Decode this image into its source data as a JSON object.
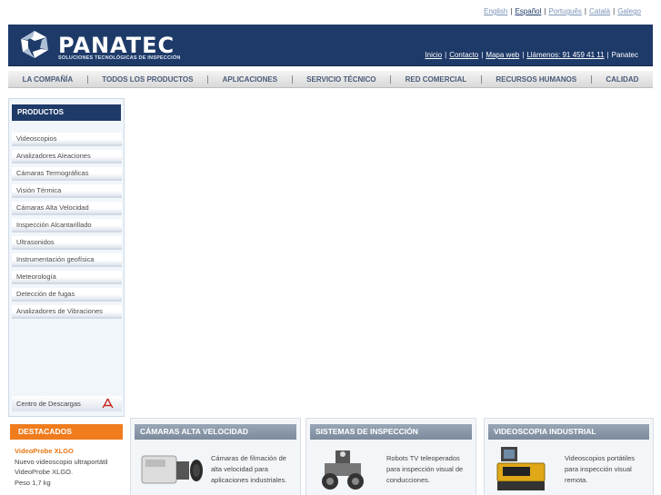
{
  "languages": [
    {
      "label": "English",
      "active": false
    },
    {
      "label": "Español",
      "active": true
    },
    {
      "label": "Português",
      "active": false
    },
    {
      "label": "Català",
      "active": false
    },
    {
      "label": "Galego",
      "active": false
    }
  ],
  "header": {
    "brand": "PANATEC",
    "tagline": "SOLUCIONES TECNOLÓGICAS DE INSPECCIÓN",
    "nav": [
      "Inicio",
      "Contacto",
      "Mapa web",
      "Llámenos: 91 459 41 11"
    ],
    "nav_suffix": "Panatec"
  },
  "main_menu": [
    "LA COMPAÑÍA",
    "TODOS LOS PRODUCTOS",
    "APLICACIONES",
    "SERVICIO TÉCNICO",
    "RED COMERCIAL",
    "RECURSOS HUMANOS",
    "CALIDAD"
  ],
  "sidebar": {
    "title": "PRODUCTOS",
    "items": [
      "Videoscopios",
      "Analizadores Aleaciones",
      "Cámaras Termográficas",
      "Visión Térmica",
      "Cámaras Alta Velocidad",
      "Inspección Alcantarillado",
      "Ultrasonidos",
      "Instrumentación geofísica",
      "Meteorología",
      "Detección de fugas",
      "Analizadores de Vibraciones"
    ],
    "downloads": "Centro de Descargas"
  },
  "destacados": {
    "title": "DESTACADOS",
    "product": "VideoProbe XLGO",
    "lines": [
      "Nuevo videoscopio ultraportátil",
      "VideoProbe XLGO.",
      "Peso 1,7 kg"
    ]
  },
  "features": [
    {
      "title": "CÁMARAS ALTA VELOCIDAD",
      "lines": [
        "Cámaras de filmación de",
        "alta velocidad para",
        "aplicaciones industriales."
      ]
    },
    {
      "title": "SISTEMAS DE INSPECCIÓN",
      "lines": [
        "Robots TV teleoperados",
        "para inspección visual de",
        "conducciones."
      ]
    },
    {
      "title": "VIDEOSCOPIA INDUSTRIAL",
      "lines": [
        "Videoscopios portátiles",
        "para inspección visual",
        "remota."
      ]
    }
  ],
  "colors": {
    "brand_navy": "#1e3a68",
    "accent_orange": "#f07c1e",
    "feature_header": "#8a98a9"
  }
}
